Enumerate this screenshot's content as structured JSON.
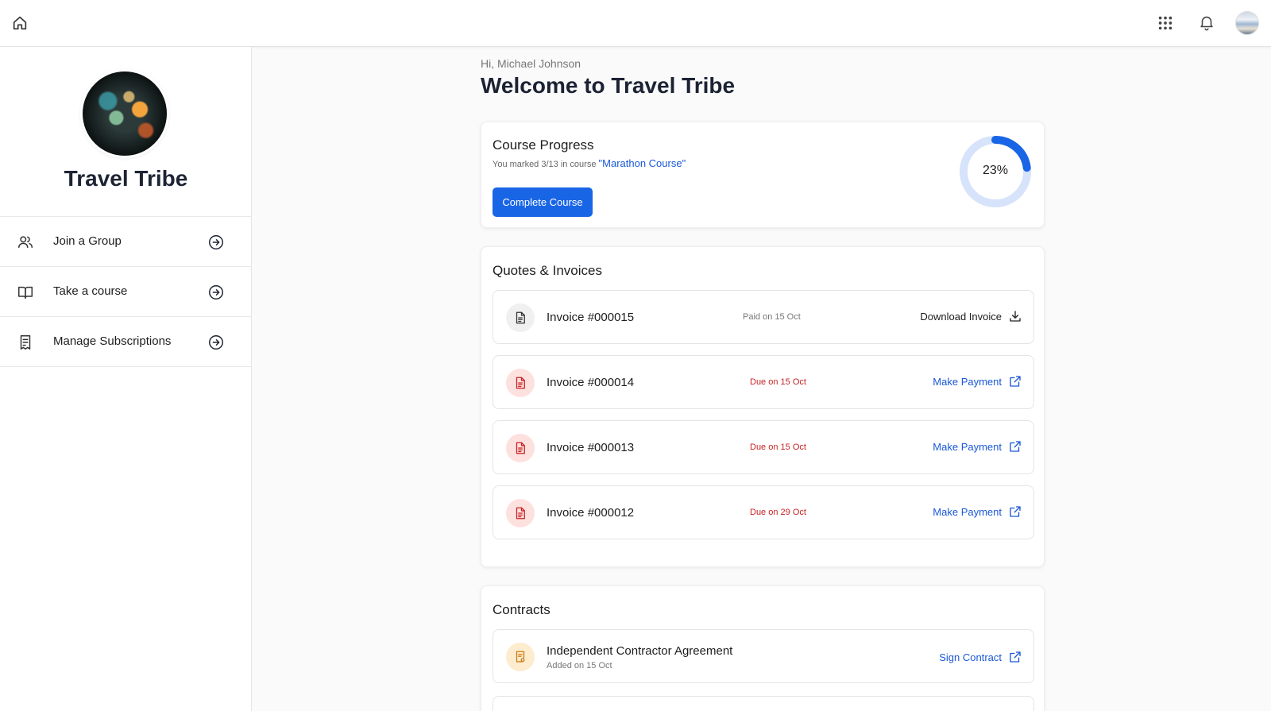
{
  "topbar": {
    "home_icon": "home-icon",
    "apps_icon": "grid-apps-icon",
    "bell_icon": "bell-icon"
  },
  "sidebar": {
    "org_name": "Travel Tribe",
    "items": [
      {
        "label": "Join a Group",
        "icon": "users-icon"
      },
      {
        "label": "Take a course",
        "icon": "book-icon"
      },
      {
        "label": "Manage Subscriptions",
        "icon": "receipt-icon"
      }
    ]
  },
  "main": {
    "greeting": "Hi, Michael Johnson",
    "welcome": "Welcome to Travel Tribe",
    "progress": {
      "title": "Course Progress",
      "marked_text": "You marked 3/13 in course",
      "course_name": "\"Marathon Course\"",
      "button_label": "Complete Course",
      "percent_label": "23%",
      "fraction": 0.23
    },
    "invoices": {
      "title": "Quotes & Invoices",
      "rows": [
        {
          "name": "Invoice #000015",
          "status": "Paid on 15 Oct",
          "action": "Download Invoice",
          "state": "paid"
        },
        {
          "name": "Invoice #000014",
          "status": "Due on 15 Oct",
          "action": "Make Payment",
          "state": "due"
        },
        {
          "name": "Invoice #000013",
          "status": "Due on 15 Oct",
          "action": "Make Payment",
          "state": "due"
        },
        {
          "name": "Invoice #000012",
          "status": "Due on 29 Oct",
          "action": "Make Payment",
          "state": "due"
        }
      ]
    },
    "contracts": {
      "title": "Contracts",
      "rows": [
        {
          "name": "Independent Contractor Agreement",
          "added": "Added on 15 Oct",
          "action": "Sign Contract"
        }
      ]
    }
  },
  "colors": {
    "accent": "#1865e6",
    "link": "#1a58d6",
    "due": "#c62222",
    "due_badge_bg": "#fde1df",
    "paid_badge_bg": "#f0f0f0",
    "contract_badge_bg": "#fdeccd",
    "ring_track": "#d7e3fb"
  }
}
